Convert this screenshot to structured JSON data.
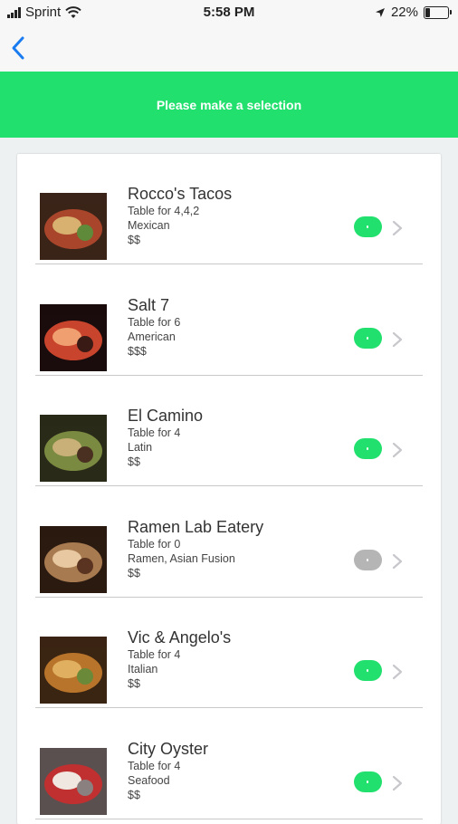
{
  "status_bar": {
    "carrier": "Sprint",
    "time": "5:58 PM",
    "battery_percent": "22%",
    "battery_level": 0.22
  },
  "nav": {
    "back_icon": "chevron-left-icon"
  },
  "banner": {
    "text": "Please make a selection"
  },
  "colors": {
    "accent": "#22e06e",
    "toggle_off": "#b5b5b5",
    "back_blue": "#1a7cf0"
  },
  "restaurants": [
    {
      "name": "Rocco's Tacos",
      "table": "Table for 4,4,2",
      "cuisine": "Mexican",
      "price": "$$",
      "available": true
    },
    {
      "name": "Salt 7",
      "table": "Table for 6",
      "cuisine": "American",
      "price": "$$$",
      "available": true
    },
    {
      "name": "El Camino",
      "table": "Table for 4",
      "cuisine": "Latin",
      "price": "$$",
      "available": true
    },
    {
      "name": "Ramen Lab Eatery",
      "table": "Table for 0",
      "cuisine": "Ramen, Asian Fusion",
      "price": "$$",
      "available": false
    },
    {
      "name": "Vic & Angelo's",
      "table": "Table for 4",
      "cuisine": "Italian",
      "price": "$$",
      "available": true
    },
    {
      "name": "City Oyster",
      "table": "Table for 4",
      "cuisine": "Seafood",
      "price": "$$",
      "available": true
    }
  ]
}
